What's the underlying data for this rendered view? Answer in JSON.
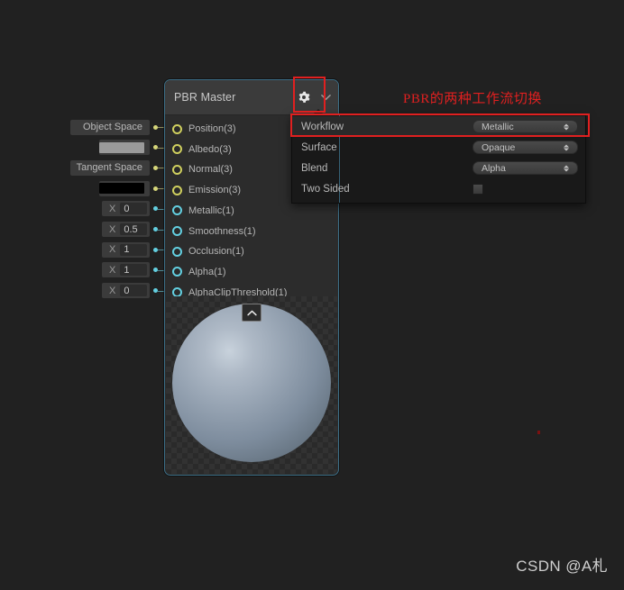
{
  "node": {
    "title": "PBR Master",
    "gear_icon": "gear-icon",
    "chevron_icon": "chevron-down-icon",
    "collapse_icon": "chevron-up-icon",
    "ports": [
      {
        "label": "Position(3)",
        "color": "#cfcf5e",
        "widget": "space",
        "value": "Object Space"
      },
      {
        "label": "Albedo(3)",
        "color": "#cfcf5e",
        "widget": "swatch",
        "value": "#9a9a9a"
      },
      {
        "label": "Normal(3)",
        "color": "#cfcf5e",
        "widget": "space",
        "value": "Tangent Space"
      },
      {
        "label": "Emission(3)",
        "color": "#cfcf5e",
        "widget": "swatch",
        "value": "#000000"
      },
      {
        "label": "Metallic(1)",
        "color": "#63cfe0",
        "widget": "vector",
        "axis": "X",
        "value": "0"
      },
      {
        "label": "Smoothness(1)",
        "color": "#63cfe0",
        "widget": "vector",
        "axis": "X",
        "value": "0.5"
      },
      {
        "label": "Occlusion(1)",
        "color": "#63cfe0",
        "widget": "vector",
        "axis": "X",
        "value": "1"
      },
      {
        "label": "Alpha(1)",
        "color": "#63cfe0",
        "widget": "vector",
        "axis": "X",
        "value": "1"
      },
      {
        "label": "AlphaClipThreshold(1)",
        "color": "#63cfe0",
        "widget": "vector",
        "axis": "X",
        "value": "0"
      }
    ]
  },
  "settings_panel": {
    "rows": [
      {
        "label": "Workflow",
        "control": "enum",
        "value": "Metallic",
        "highlighted": true
      },
      {
        "label": "Surface",
        "control": "enum",
        "value": "Opaque",
        "highlighted": false
      },
      {
        "label": "Blend",
        "control": "enum",
        "value": "Alpha",
        "highlighted": false
      },
      {
        "label": "Two Sided",
        "control": "checkbox",
        "value": "",
        "highlighted": false
      }
    ]
  },
  "annotation": {
    "text": "PBR的两种工作流切换",
    "color": "#e02020"
  },
  "watermark": {
    "text": "CSDN @A札"
  },
  "colors": {
    "background": "#212121",
    "node_body": "#2c2c2c",
    "node_titlebar": "#3b3b3b",
    "node_border": "#3c6e86",
    "panel_background": "#191919",
    "port_yellow": "#cfcf5e",
    "port_cyan": "#63cfe0",
    "annotation_red": "#e02020"
  }
}
